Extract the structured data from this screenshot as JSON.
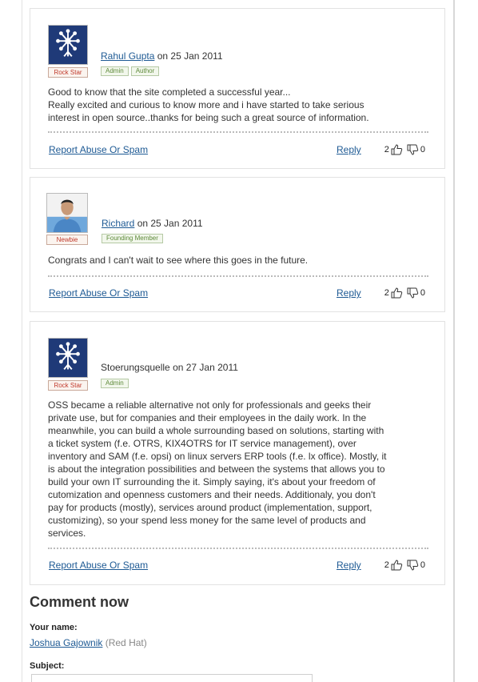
{
  "comments": [
    {
      "author": "Rahul Gupta",
      "author_linked": true,
      "date_text": " on 25 Jan 2011",
      "rank": "Rock Star",
      "avatar": "flower-logo-icon",
      "badges": [
        "Admin",
        "Author"
      ],
      "body": "Good to know that the site completed a successful year...\nReally excited and curious to know more and i have started to take serious interest in open source..thanks for being such a great source of information.",
      "report_label": "Report Abuse Or Spam",
      "reply_label": "Reply",
      "up_votes": "2",
      "down_votes": "0"
    },
    {
      "author": "Richard",
      "author_linked": true,
      "date_text": " on 25 Jan 2011",
      "rank": "Newbie",
      "avatar": "user-photo",
      "badges": [
        "Founding Member"
      ],
      "body": "Congrats and I can't wait to see where this goes in the future.",
      "report_label": "Report Abuse Or Spam",
      "reply_label": "Reply",
      "up_votes": "2",
      "down_votes": "0"
    },
    {
      "author": "Stoerungsquelle",
      "author_linked": false,
      "date_text": " on 27 Jan 2011",
      "rank": "Rock Star",
      "avatar": "flower-logo-icon",
      "badges": [
        "Admin"
      ],
      "body": "OSS became a reliable alternative not only for professionals and geeks their private use, but for companies and their employees in the daily work. In the meanwhile, you can build a whole surrounding based on solutions, starting with a ticket system (f.e. OTRS, KIX4OTRS for IT service management), over inventory and SAM (f.e. opsi) on linux servers ERP tools (f.e. lx office). Mostly, it is about the integration possibilities and between the systems that allows you to build your own IT surrounding the it. Simply saying, it's about your freedom of cutomization and openness customers and their needs. Additionaly, you don't pay for products (mostly), services around product (implementation, support, customizing), so your spend less money for the same level of products and services.",
      "report_label": "Report Abuse Or Spam",
      "reply_label": "Reply",
      "up_votes": "2",
      "down_votes": "0"
    }
  ],
  "comment_form": {
    "heading": "Comment now",
    "name_label": "Your name:",
    "user_name": "Joshua Gajownik",
    "user_org": " (Red Hat)",
    "subject_label": "Subject:",
    "subject_value": ""
  },
  "colors": {
    "link": "#1e5a94",
    "rank_text": "#c0392b",
    "role_text": "#5e8a3a",
    "avatar_bg": "#1f3a78"
  }
}
